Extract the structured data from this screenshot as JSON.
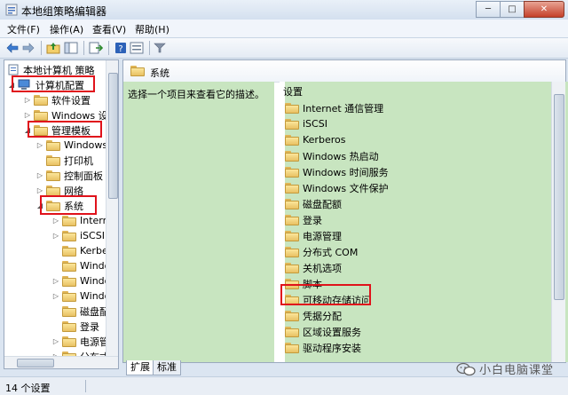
{
  "window": {
    "title": "本地组策略编辑器",
    "controls": [
      "─",
      "□",
      "✕"
    ]
  },
  "menu": [
    "文件(F)",
    "操作(A)",
    "查看(V)",
    "帮助(H)"
  ],
  "toolbar": [
    "back-icon",
    "forward-icon",
    "up-folder-icon",
    "show-hide-tree-icon",
    "export-icon",
    "help-icon",
    "properties-icon",
    "filter-icon"
  ],
  "tree": {
    "items": [
      {
        "label": "本地计算机 策略",
        "expander": ""
      },
      {
        "label": "计算机配置",
        "expander": "◢"
      },
      {
        "label": "软件设置",
        "expander": "▷"
      },
      {
        "label": "Windows 设",
        "expander": "▷"
      },
      {
        "label": "管理模板",
        "expander": "◢"
      },
      {
        "label": "Windows",
        "expander": "▷"
      },
      {
        "label": "打印机",
        "expander": ""
      },
      {
        "label": "控制面板",
        "expander": "▷"
      },
      {
        "label": "网络",
        "expander": "▷"
      },
      {
        "label": "系统",
        "expander": "◢"
      },
      {
        "label": "Intern",
        "expander": "▷"
      },
      {
        "label": "iSCSI",
        "expander": "▷"
      },
      {
        "label": "Kerbe",
        "expander": ""
      },
      {
        "label": "Windo",
        "expander": ""
      },
      {
        "label": "Windo",
        "expander": "▷"
      },
      {
        "label": "Windo",
        "expander": "▷"
      },
      {
        "label": "磁盘配",
        "expander": ""
      },
      {
        "label": "登录",
        "expander": ""
      },
      {
        "label": "电源管",
        "expander": "▷"
      },
      {
        "label": "分布式",
        "expander": "▷"
      }
    ]
  },
  "right": {
    "header": "系统",
    "description": "选择一个项目来查看它的描述。",
    "list_header": "设置",
    "items": [
      "Internet 通信管理",
      "iSCSI",
      "Kerberos",
      "Windows 热启动",
      "Windows 时间服务",
      "Windows 文件保护",
      "磁盘配额",
      "登录",
      "电源管理",
      "分布式 COM",
      "关机选项",
      "脚本",
      "可移动存储访问",
      "凭据分配",
      "区域设置服务",
      "驱动程序安装"
    ]
  },
  "tabs": [
    "扩展",
    "标准"
  ],
  "status": "14 个设置",
  "watermark": "小白电脑课堂",
  "colors": {
    "highlight": "#e0121b",
    "pane_bg": "#c8e5c0"
  }
}
